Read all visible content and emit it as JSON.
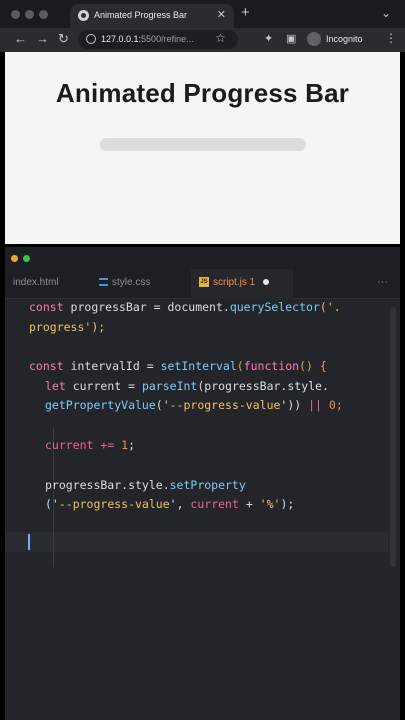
{
  "browser": {
    "tab_title": "Animated Progress Bar",
    "url_host": "127.0.0.1:",
    "url_rest": "5500/refine...",
    "profile_label": "Incognito"
  },
  "page": {
    "title": "Animated Progress Bar",
    "progress": 0
  },
  "editor": {
    "tabs": [
      {
        "label": "index.html"
      },
      {
        "label": "style.css"
      },
      {
        "label": "script.js 1"
      }
    ]
  },
  "code": {
    "l1a": "const ",
    "l1b": "progressBar",
    "l1c": " = ",
    "l1d": "document",
    "l1e": ".",
    "l1f": "querySelector",
    "l1g": "('.",
    "l2a": "progress",
    "l2b": "');",
    "l3a": "const ",
    "l3b": "intervalId",
    "l3c": " = ",
    "l3d": "setInterval",
    "l3e": "(",
    "l3f": "function",
    "l3g": "() {",
    "l4a": "let ",
    "l4b": "current",
    "l4c": " = ",
    "l4d": "parseInt",
    "l4e": "(progressBar.style.",
    "l5a": "getPropertyValue",
    "l5b": "('",
    "l5c": "--progress-value",
    "l5d": "')) ",
    "l5e": "||",
    "l5f": " 0;",
    "l6a": "current",
    "l6b": " += ",
    "l6c": "1",
    "l6d": ";",
    "l7a": "progressBar.style.",
    "l7b": "setProperty",
    "l8a": "('",
    "l8b": "--progress-value",
    "l8c": "', ",
    "l8d": "current",
    "l8e": " + ",
    "l8f": "'%'",
    "l8g": ");"
  }
}
